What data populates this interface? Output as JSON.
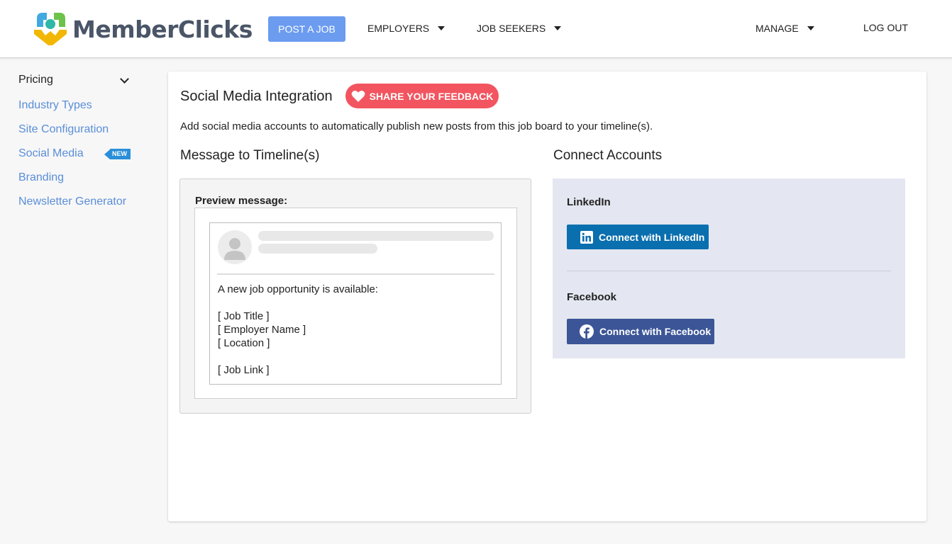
{
  "header": {
    "logo_text": "MemberClicks",
    "post_job_label": "POST A JOB",
    "nav": {
      "employers": "EMPLOYERS",
      "job_seekers": "JOB SEEKERS",
      "manage": "MANAGE",
      "logout": "LOG OUT"
    }
  },
  "sidebar": {
    "pricing": "Pricing",
    "items": [
      {
        "label": "Industry Types"
      },
      {
        "label": "Site Configuration"
      },
      {
        "label": "Social Media",
        "badge": "NEW"
      },
      {
        "label": "Branding"
      },
      {
        "label": "Newsletter Generator"
      }
    ]
  },
  "main": {
    "title": "Social Media Integration",
    "feedback_label": "SHARE YOUR FEEDBACK",
    "description": "Add social media accounts to automatically publish new posts from this job board to your timeline(s).",
    "message_heading": "Message to Timeline(s)",
    "connect_heading": "Connect Accounts",
    "preview": {
      "label": "Preview message:",
      "lines": [
        "A new job opportunity is available:",
        "[ Job Title ]",
        "[ Employer Name ]",
        "[ Location ]",
        "[ Job Link ]"
      ]
    },
    "accounts": {
      "linkedin_label": "LinkedIn",
      "linkedin_button": "Connect with LinkedIn",
      "facebook_label": "Facebook",
      "facebook_button": "Connect with Facebook"
    }
  },
  "colors": {
    "primary_button": "#6b9cf0",
    "link": "#5a8ed8",
    "feedback": "#f2555f",
    "linkedin": "#0a6fae",
    "facebook": "#3b5597",
    "new_badge": "#2a8fd8"
  }
}
